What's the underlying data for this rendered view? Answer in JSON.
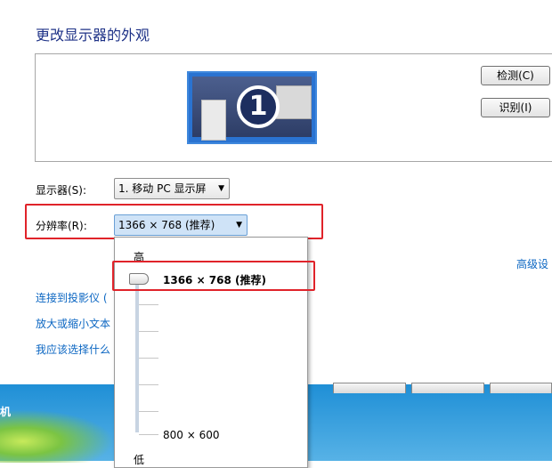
{
  "window": {
    "title": "更改显示器的外观"
  },
  "preview": {
    "monitor_number": "1"
  },
  "buttons": {
    "detect": "检测(C)",
    "identify": "识别(I)"
  },
  "display": {
    "label": "显示器(S):",
    "value": "1. 移动 PC 显示屏"
  },
  "resolution": {
    "label": "分辨率(R):",
    "value": "1366 × 768 (推荐)",
    "slider": {
      "high_label": "高",
      "low_label": "低",
      "current": "1366 × 768 (推荐)",
      "min": "800 × 600"
    }
  },
  "advanced_link": "高级设",
  "links": [
    "连接到投影仪 (",
    "放大或缩小文本",
    "我应该选择什么"
  ],
  "colors": {
    "title": "#1e3287",
    "link": "#0b66c2",
    "highlight": "#e0232a"
  }
}
